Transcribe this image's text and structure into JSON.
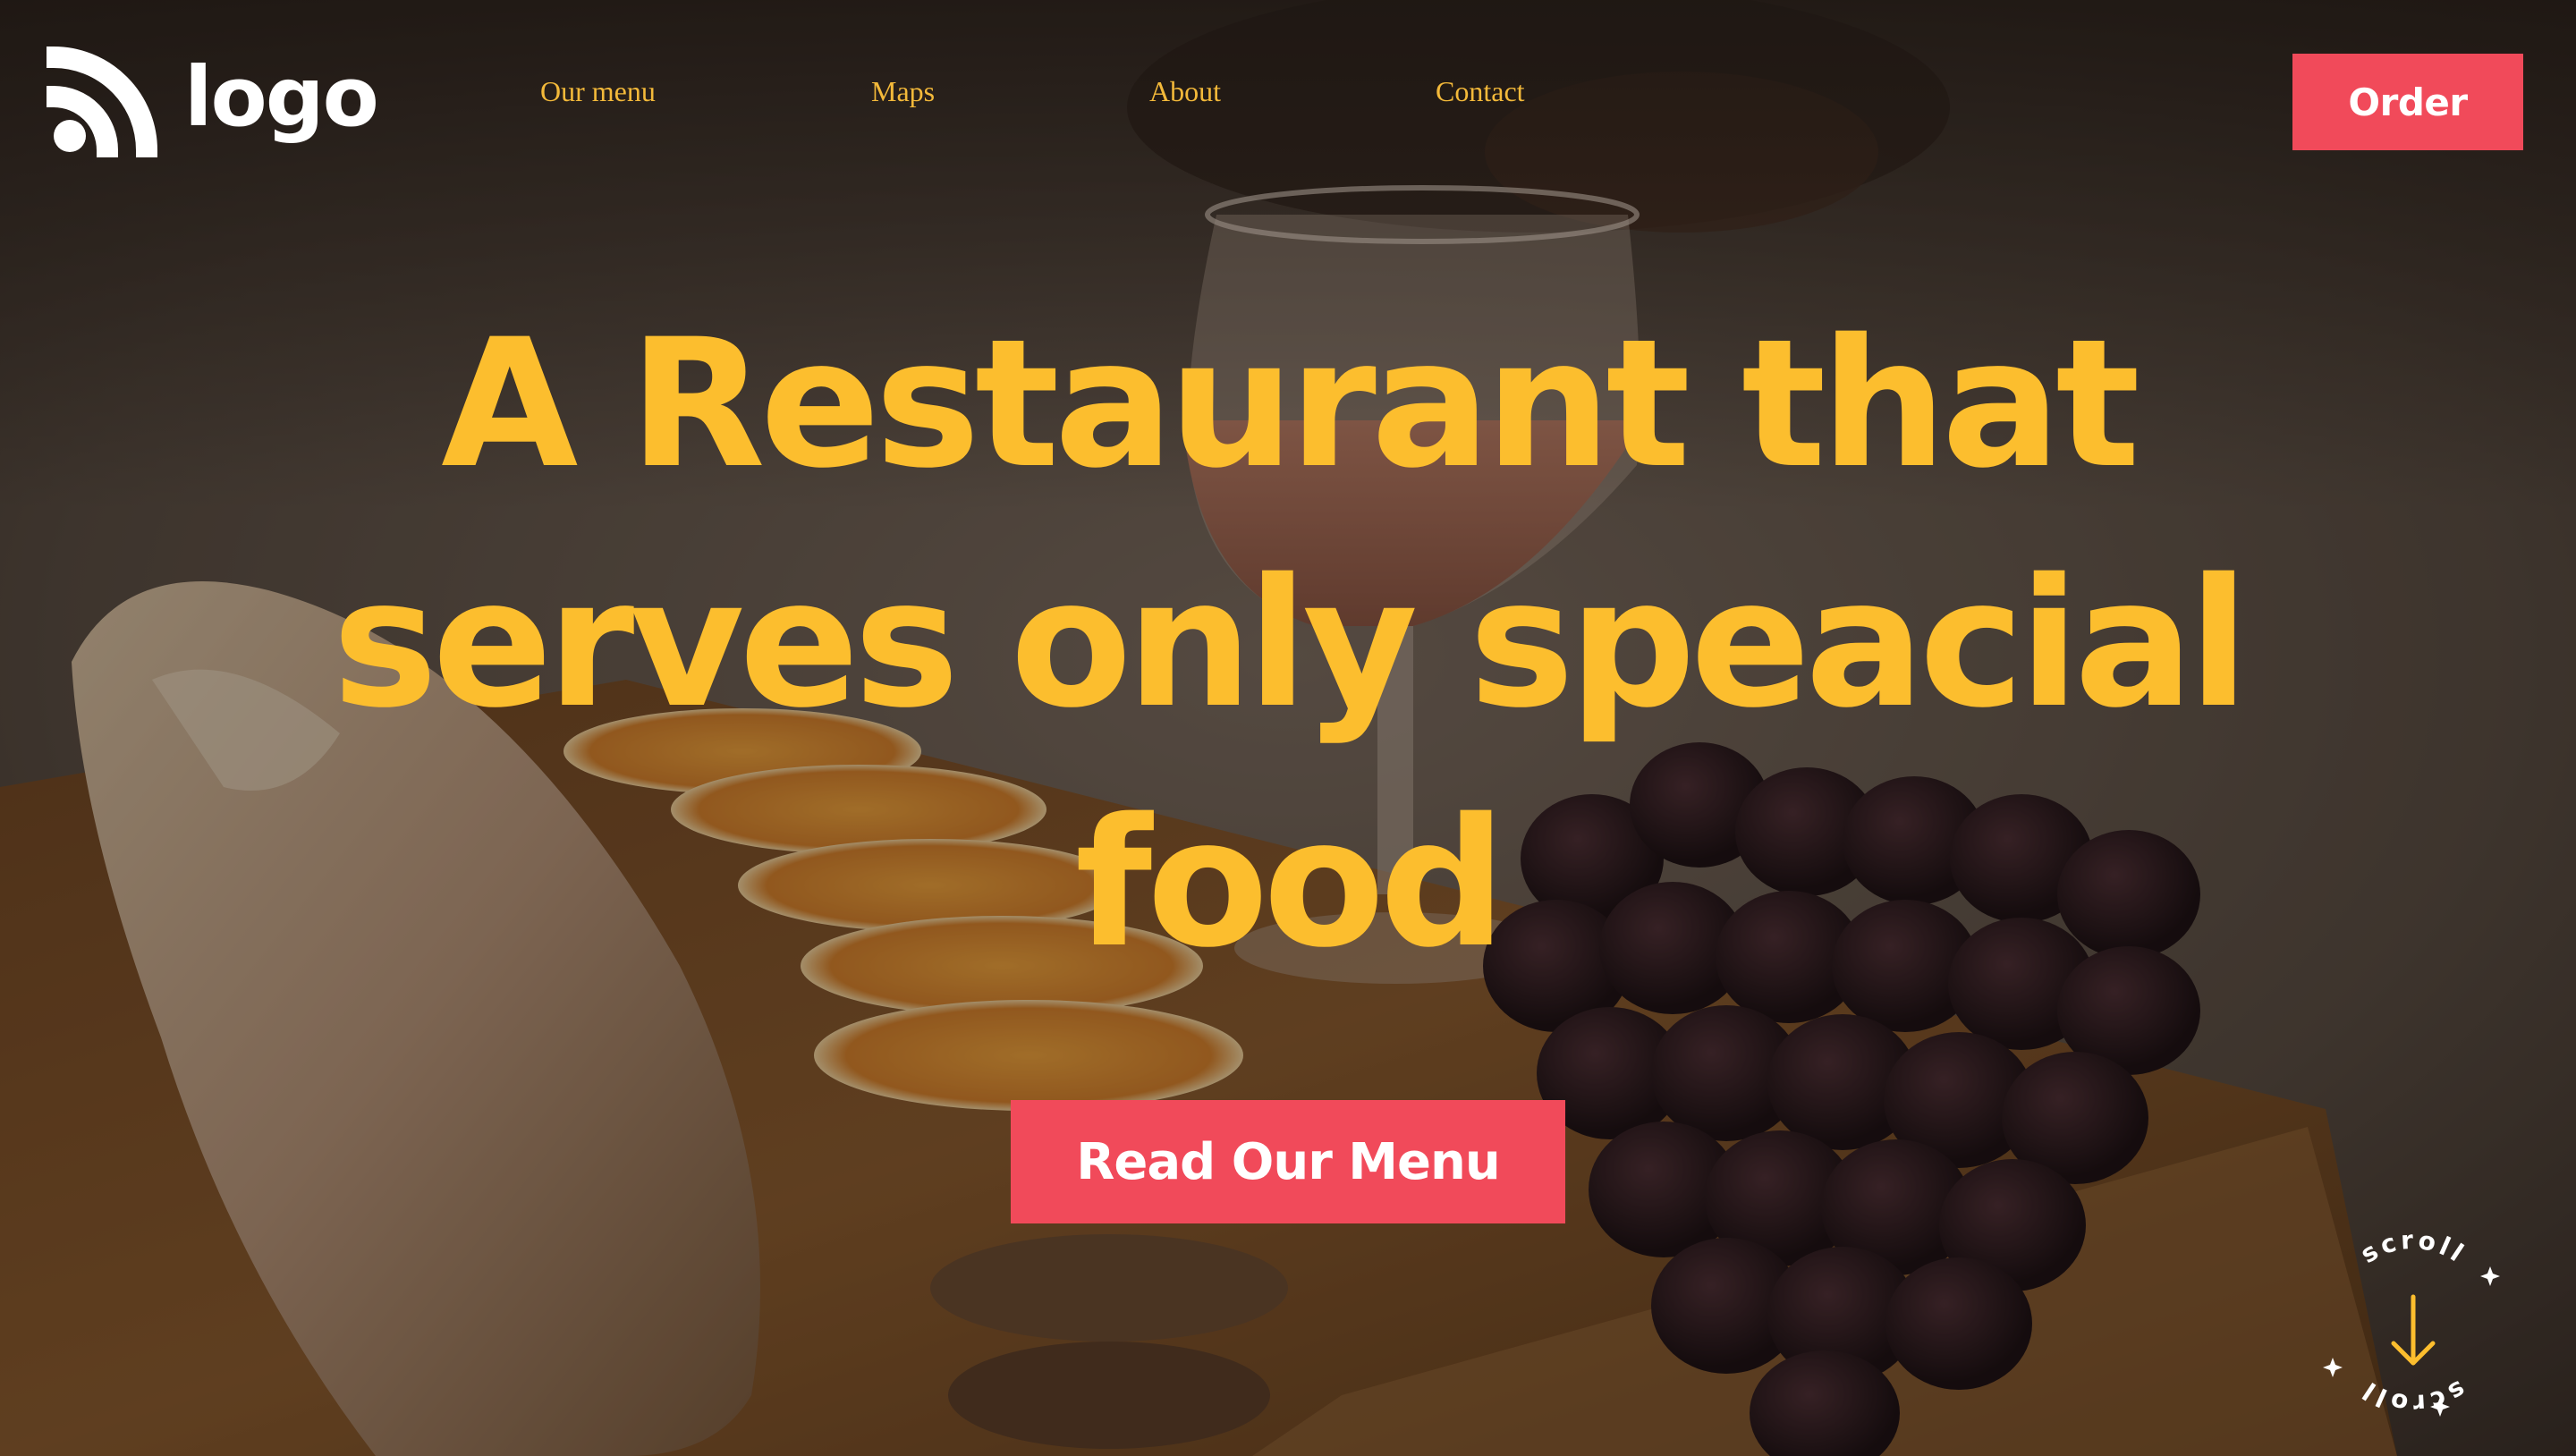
{
  "header": {
    "logo_text": "logo",
    "nav": [
      {
        "label": "Our menu"
      },
      {
        "label": "Maps"
      },
      {
        "label": "About"
      },
      {
        "label": "Contact"
      }
    ],
    "order_label": "Order"
  },
  "hero": {
    "headline_lines": [
      "A Restaurant that",
      "serves only speacial",
      "food"
    ],
    "cta_label": "Read Our Menu",
    "scroll_text": "scroll",
    "background": "dimmed photo of a table with bread, orange slices, a glass of rosé wine and grapes on a wooden board"
  },
  "colors": {
    "accent_yellow": "#fcbe2e",
    "nav_text": "#f3b93a",
    "button_red": "#f14a5a",
    "white": "#ffffff"
  },
  "icons": {
    "logo": "signal-arcs-icon",
    "scroll": "arrow-down-icon",
    "separator": "star-icon"
  }
}
